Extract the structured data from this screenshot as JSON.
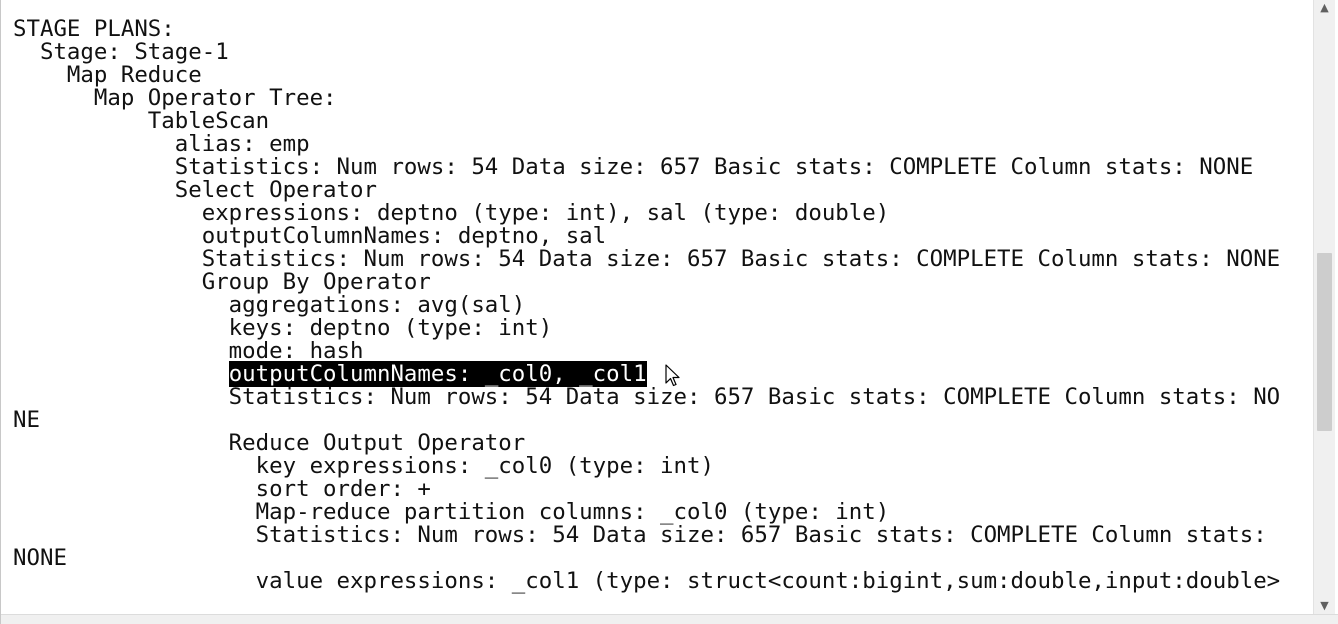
{
  "terminal": {
    "lines": [
      "STAGE PLANS:",
      "  Stage: Stage-1",
      "    Map Reduce",
      "      Map Operator Tree:",
      "          TableScan",
      "            alias: emp",
      "            Statistics: Num rows: 54 Data size: 657 Basic stats: COMPLETE Column stats: NONE",
      "            Select Operator",
      "              expressions: deptno (type: int), sal (type: double)",
      "              outputColumnNames: deptno, sal",
      "              Statistics: Num rows: 54 Data size: 657 Basic stats: COMPLETE Column stats: NONE",
      "              Group By Operator",
      "                aggregations: avg(sal)",
      "                keys: deptno (type: int)",
      "                mode: hash",
      "                outputColumnNames: _col0, _col1",
      "                Statistics: Num rows: 54 Data size: 657 Basic stats: COMPLETE Column stats: NO",
      "NE",
      "",
      "                Reduce Output Operator",
      "                  key expressions: _col0 (type: int)",
      "                  sort order: +",
      "                  Map-reduce partition columns: _col0 (type: int)",
      "                  Statistics: Num rows: 54 Data size: 657 Basic stats: COMPLETE Column stats:",
      "NONE",
      "",
      "                  value expressions: _col1 (type: struct<count:bigint,sum:double,input:double>"
    ],
    "selected_text": "outputColumnNames: _col0, _col1",
    "selected_indent": "                "
  },
  "scrollbar": {
    "up_arrow": "▲",
    "down_arrow": "▼",
    "position": 0.55
  },
  "colors": {
    "text": "#111111",
    "background": "#ffffff",
    "selection_bg": "#000000",
    "selection_fg": "#ffffff"
  }
}
